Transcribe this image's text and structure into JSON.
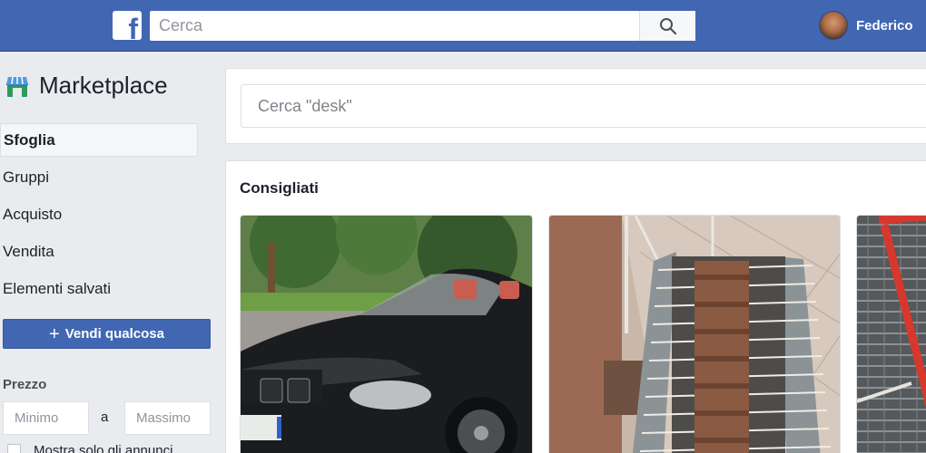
{
  "header": {
    "logo_letter": "f",
    "search_placeholder": "Cerca",
    "user_name": "Federico"
  },
  "sidebar": {
    "title": "Marketplace",
    "items": [
      {
        "label": "Sfoglia",
        "active": true
      },
      {
        "label": "Gruppi"
      },
      {
        "label": "Acquisto"
      },
      {
        "label": "Vendita"
      },
      {
        "label": "Elementi salvati"
      }
    ],
    "sell_button": "Vendi qualcosa",
    "sell_icon": "+",
    "price_label": "Prezzo",
    "min_placeholder": "Minimo",
    "range_sep": "a",
    "max_placeholder": "Massimo",
    "only_label": "Mostra solo gli annunci"
  },
  "main": {
    "search_placeholder": "Cerca \"desk\"",
    "section_title": "Consigliati",
    "listings": [
      {
        "image": "black convertible car"
      },
      {
        "image": "meat skewers on grill"
      },
      {
        "image": "red metal frame on grates"
      }
    ]
  },
  "colors": {
    "brand_blue": "#4267b2",
    "page_bg": "#e9ebee"
  }
}
